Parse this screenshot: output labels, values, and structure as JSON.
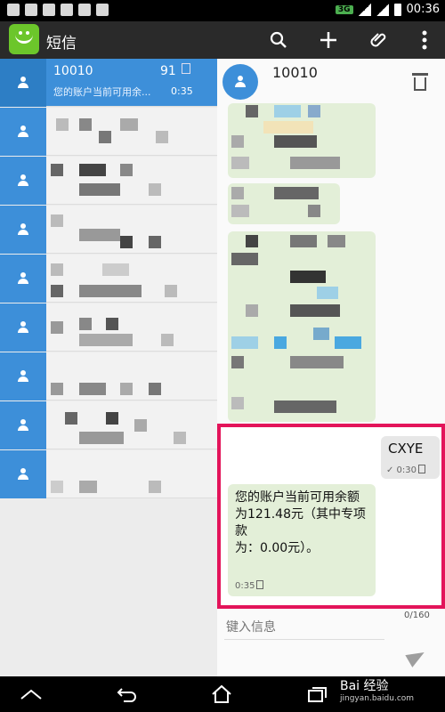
{
  "status_bar": {
    "time": "00:36",
    "network": "3G"
  },
  "action_bar": {
    "title": "短信"
  },
  "conversation_list": {
    "selected": {
      "name": "10010",
      "count": "91",
      "preview": "您的账户当前可用余...",
      "time": "0:35"
    }
  },
  "conversation": {
    "contact": "10010",
    "messages": [
      {
        "direction": "outgoing",
        "text": "CXYE",
        "time": "✓ 0:30"
      },
      {
        "direction": "incoming",
        "text": "您的账户当前可用余额\n为121.48元（其中专项款\n为：0.00元）。",
        "time": "0:35"
      }
    ],
    "compose_placeholder": "键入信息",
    "char_counter": "0/160"
  },
  "watermark": {
    "brand": "Bai 经验",
    "url": "jingyan.baidu.com"
  },
  "colors": {
    "accent": "#3d8fd9",
    "highlight": "#e3145a",
    "bubble_in": "#e3efd8"
  }
}
